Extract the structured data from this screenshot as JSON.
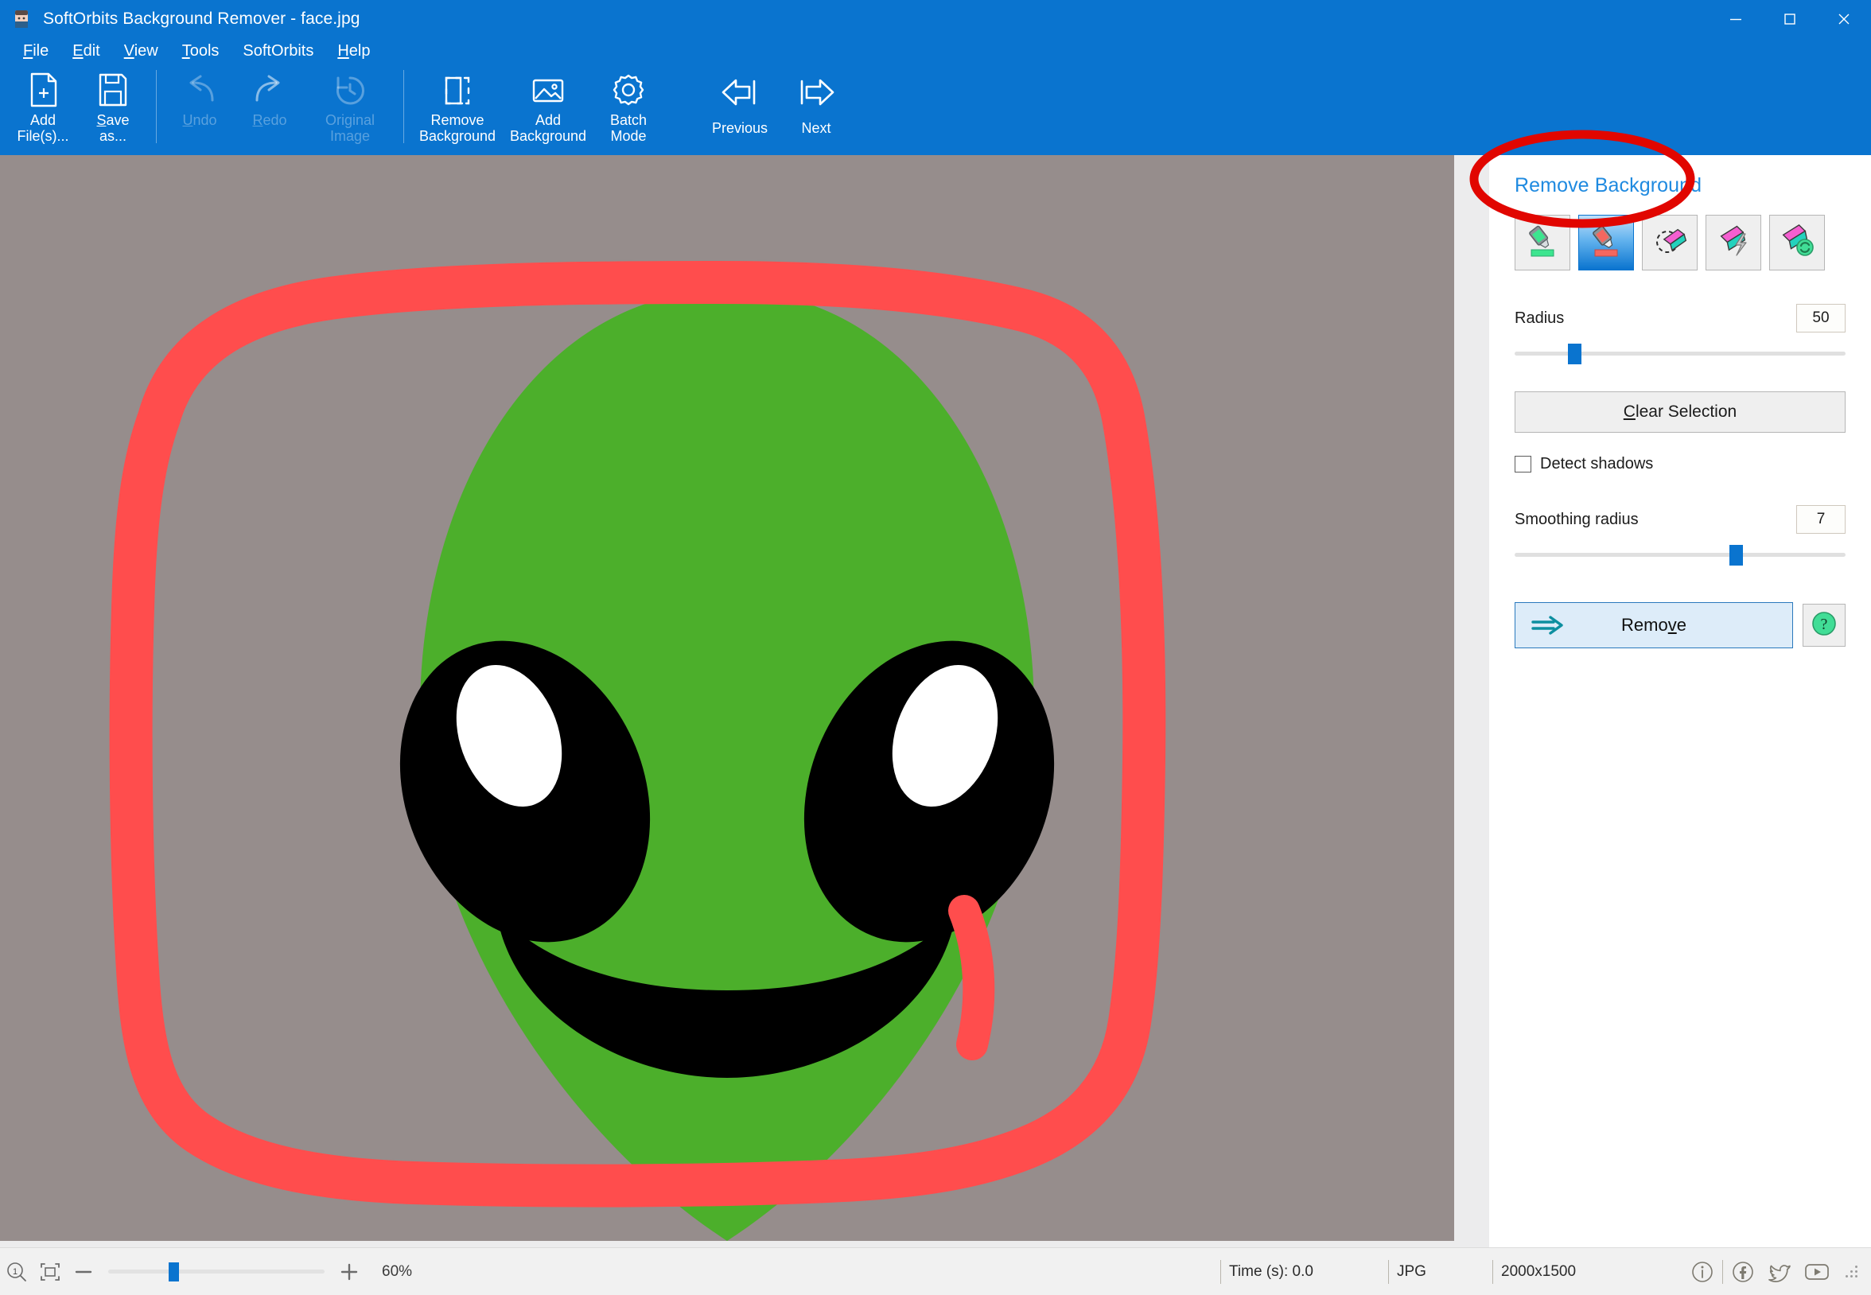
{
  "window": {
    "title": "SoftOrbits Background Remover - face.jpg",
    "app_icon": "app-icon",
    "controls": {
      "minimize": "minimize-icon",
      "maximize": "maximize-icon",
      "close": "close-icon"
    },
    "accent_color": "#0a74cf"
  },
  "menubar": {
    "items": [
      {
        "label": "File",
        "accel": "F"
      },
      {
        "label": "Edit",
        "accel": "E"
      },
      {
        "label": "View",
        "accel": "V"
      },
      {
        "label": "Tools",
        "accel": "T"
      },
      {
        "label": "SoftOrbits",
        "accel": ""
      },
      {
        "label": "Help",
        "accel": "H"
      }
    ]
  },
  "toolbar": {
    "buttons": [
      {
        "label": "Add\nFile(s)...",
        "icon": "add-file-icon",
        "enabled": true
      },
      {
        "label": "Save\nas...",
        "icon": "save-as-icon",
        "enabled": true
      },
      {
        "label": "Undo",
        "icon": "undo-icon",
        "enabled": false
      },
      {
        "label": "Redo",
        "icon": "redo-icon",
        "enabled": false
      },
      {
        "label": "Original\nImage",
        "icon": "original-image-icon",
        "enabled": false
      },
      {
        "label": "Remove\nBackground",
        "icon": "remove-background-icon",
        "enabled": true
      },
      {
        "label": "Add\nBackground",
        "icon": "add-background-icon",
        "enabled": true
      },
      {
        "label": "Batch\nMode",
        "icon": "batch-mode-icon",
        "enabled": true
      },
      {
        "label": "Previous",
        "icon": "previous-icon",
        "enabled": true
      },
      {
        "label": "Next",
        "icon": "next-icon",
        "enabled": true
      }
    ]
  },
  "canvas": {
    "background_color": "#968d8c",
    "surface_color": "#ececed",
    "artwork": {
      "description": "alien-face-drawing",
      "head_color": "#4caf2b",
      "eye_color": "#000000",
      "highlight_color": "#ffffff",
      "marker_stroke_color": "#ff4d4d"
    }
  },
  "sidebar": {
    "panel_title": "Remove Background",
    "title_color": "#1f8ae0",
    "tools": [
      {
        "name": "keep-marker-tool",
        "icon": "marker-green-icon",
        "active": false
      },
      {
        "name": "remove-marker-tool",
        "icon": "marker-red-icon",
        "active": true
      },
      {
        "name": "lasso-select-tool",
        "icon": "lasso-icon",
        "active": false
      },
      {
        "name": "magic-wand-tool",
        "icon": "magic-wand-icon",
        "active": false
      },
      {
        "name": "restore-tool",
        "icon": "restore-icon",
        "active": false
      }
    ],
    "radius": {
      "label": "Radius",
      "value": "50",
      "min": 0,
      "max": 100,
      "percent": 16
    },
    "clear_selection": {
      "label": "Clear Selection",
      "accel": "C"
    },
    "detect_shadows": {
      "label": "Detect shadows",
      "checked": false
    },
    "smoothing_radius": {
      "label": "Smoothing radius",
      "value": "7",
      "min": 0,
      "max": 100,
      "percent": 65
    },
    "remove": {
      "label": "Remove",
      "accel": "v",
      "icon": "arrow-right-icon"
    },
    "help": {
      "label": "?",
      "icon": "help-icon",
      "color": "#2ecc8f"
    },
    "annotation": {
      "shape": "ellipse",
      "color": "#e10600",
      "target": "remove-button"
    }
  },
  "statusbar": {
    "zoom_actual_icon": "zoom-actual-size-icon",
    "fit_icon": "fit-to-window-icon",
    "minus_label": "-",
    "plus_label": "+",
    "zoom_percent": "60%",
    "zoom_slider_percent": 28,
    "time_label": "Time (s): 0.0",
    "format_label": "JPG",
    "dimensions_label": "2000x1500",
    "social": [
      {
        "name": "info-icon",
        "label": "i"
      },
      {
        "name": "facebook-icon",
        "label": "f"
      },
      {
        "name": "twitter-icon",
        "label": "t"
      },
      {
        "name": "youtube-icon",
        "label": "y"
      }
    ]
  }
}
